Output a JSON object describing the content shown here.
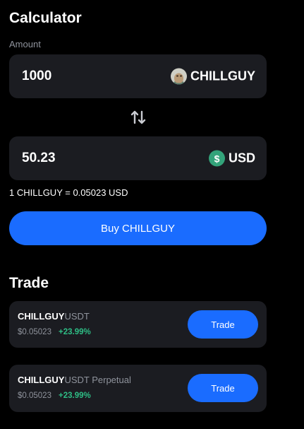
{
  "calculator": {
    "title": "Calculator",
    "amount_label": "Amount",
    "from": {
      "value": "1000",
      "unit": "CHILLGUY",
      "icon": "chillguy-token-icon"
    },
    "swap_icon": "swap-arrows-icon",
    "to": {
      "value": "50.23",
      "unit": "USD",
      "icon": "usd-icon",
      "icon_glyph": "$"
    },
    "rate": "1 CHILLGUY = 0.05023 USD",
    "buy_label": "Buy CHILLGUY"
  },
  "trade": {
    "title": "Trade",
    "items": [
      {
        "base": "CHILLGUY",
        "quote": "USDT",
        "price": "$0.05023",
        "change": "+23.99%",
        "button": "Trade"
      },
      {
        "base": "CHILLGUY",
        "quote": "USDT Perpetual",
        "price": "$0.05023",
        "change": "+23.99%",
        "button": "Trade"
      }
    ]
  },
  "colors": {
    "background": "#000000",
    "panel": "#1b1c21",
    "accent": "#1a6cff",
    "positive": "#2ebd85",
    "muted": "#8f939c"
  }
}
